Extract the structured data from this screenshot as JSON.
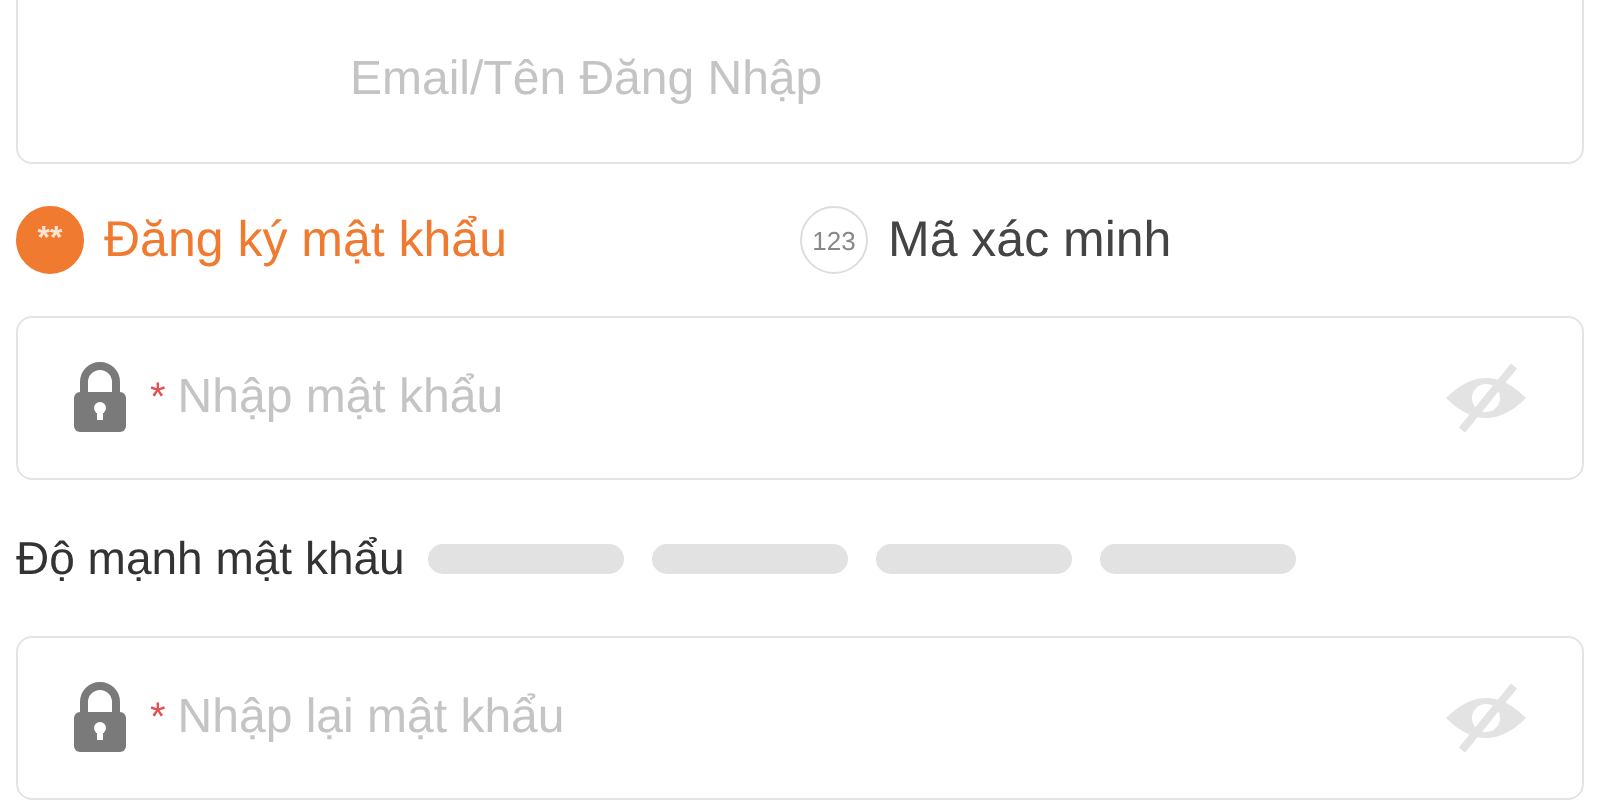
{
  "login_field": {
    "placeholder": "Email/Tên Đăng Nhập"
  },
  "tabs": [
    {
      "badge": "**",
      "label": "Đăng ký mật khẩu",
      "selected": true
    },
    {
      "badge": "123",
      "label": "Mã xác minh",
      "selected": false
    }
  ],
  "password_field": {
    "required_mark": "*",
    "placeholder": "Nhập mật khẩu"
  },
  "strength": {
    "label": "Độ mạnh mật khẩu"
  },
  "confirm_field": {
    "required_mark": "*",
    "placeholder": "Nhập lại mật khẩu"
  }
}
